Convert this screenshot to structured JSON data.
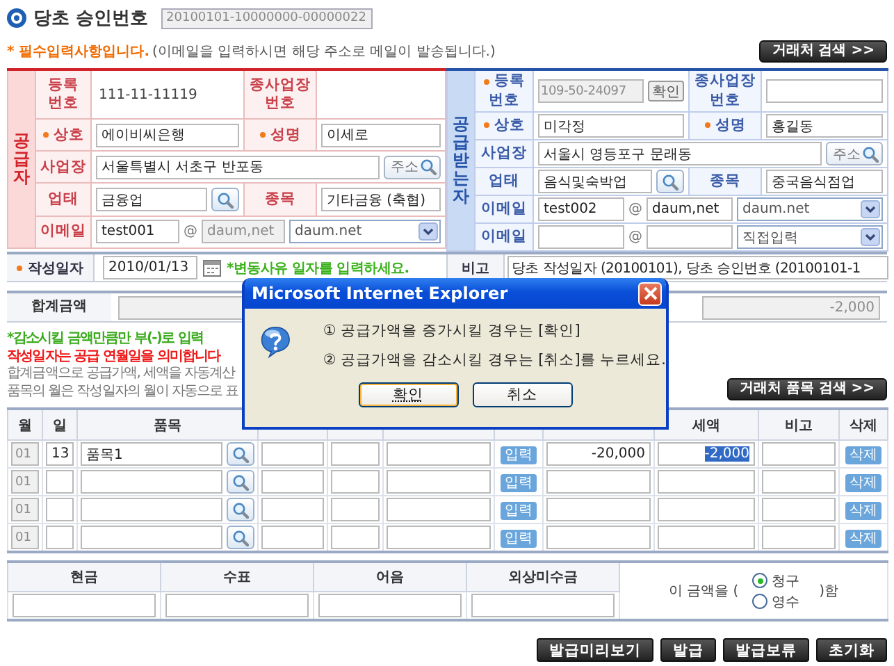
{
  "header": {
    "title": "당초 승인번호",
    "approval_no": "20100101-10000000-00000022"
  },
  "notice": {
    "required": "* 필수입력사항입니다.",
    "hint": "(이메일을 입력하시면 해당 주소로 메일이 발송됩니다.)",
    "search_button": "거래처 검색 >>"
  },
  "parties": [
    {
      "color": "#d2222a",
      "title": "공급자",
      "rows": [
        {
          "cells": [
            {
              "kind": "label",
              "text": "등록 번호",
              "required": false
            },
            {
              "kind": "text",
              "value": "111-11-11119"
            },
            {
              "kind": "label",
              "text": "종사업장 번호",
              "required": false
            },
            {
              "kind": "blank"
            }
          ]
        },
        {
          "cells": [
            {
              "kind": "label",
              "text": "상호",
              "required": true
            },
            {
              "kind": "field",
              "value": "에이비씨은행"
            },
            {
              "kind": "label",
              "text": "성명",
              "required": true
            },
            {
              "kind": "field",
              "value": "이세로"
            }
          ]
        },
        {
          "cells": [
            {
              "kind": "label",
              "text": "사업장",
              "required": false
            },
            {
              "kind": "address",
              "value": "서울특별시 서초구 반포동",
              "button": "주소",
              "colspan": 3
            }
          ]
        },
        {
          "cells": [
            {
              "kind": "label",
              "text": "업태",
              "required": false
            },
            {
              "kind": "search",
              "value": "금융업"
            },
            {
              "kind": "label",
              "text": "종목",
              "required": false
            },
            {
              "kind": "field",
              "value": "기타금융 (축협)"
            }
          ]
        },
        {
          "cells": [
            {
              "kind": "label",
              "text": "이메일",
              "required": false
            },
            {
              "kind": "email",
              "user": "test001",
              "at": "@",
              "domain": "daum,net",
              "domain_disabled": true,
              "select": "daum.net",
              "colspan": 3
            }
          ]
        }
      ]
    },
    {
      "color": "#2654a8",
      "title": "공급받는자",
      "rows": [
        {
          "cells": [
            {
              "kind": "label",
              "text": "등록 번호",
              "required": true
            },
            {
              "kind": "confirm",
              "value": "109-50-24097",
              "button": "확인"
            },
            {
              "kind": "label",
              "text": "종사업장 번호",
              "required": false
            },
            {
              "kind": "field"
            }
          ]
        },
        {
          "cells": [
            {
              "kind": "label",
              "text": "상호",
              "required": true
            },
            {
              "kind": "field",
              "value": "미각정"
            },
            {
              "kind": "label",
              "text": "성명",
              "required": true
            },
            {
              "kind": "field",
              "value": "홍길동"
            }
          ]
        },
        {
          "cells": [
            {
              "kind": "label",
              "text": "사업장",
              "required": false
            },
            {
              "kind": "address",
              "value": "서울시 영등포구 문래동",
              "button": "주소",
              "colspan": 3
            }
          ]
        },
        {
          "cells": [
            {
              "kind": "label",
              "text": "업태",
              "required": false
            },
            {
              "kind": "search",
              "value": "음식및숙박업"
            },
            {
              "kind": "label",
              "text": "종목",
              "required": false
            },
            {
              "kind": "field",
              "value": "중국음식점업"
            }
          ]
        },
        {
          "cells": [
            {
              "kind": "label",
              "text": "이메일",
              "required": false
            },
            {
              "kind": "email",
              "user": "test002",
              "at": "@",
              "domain": "daum,net",
              "domain_disabled": false,
              "select": "daum.net",
              "colspan": 3
            }
          ]
        },
        {
          "cells": [
            {
              "kind": "label",
              "text": "이메일",
              "required": false
            },
            {
              "kind": "email",
              "at": "@",
              "domain_disabled": false,
              "select": "직접입력",
              "colspan": 3
            }
          ]
        }
      ]
    }
  ],
  "date_row": {
    "label": "작성일자",
    "required": true,
    "date": "2010/01/13",
    "note": "*변동사유 일자를 입력하세요.",
    "remark_label": "비고",
    "remark": "당초 작성일자 (20100101), 당초 승인번호 (20100101-1"
  },
  "total": {
    "label": "합계금액",
    "fields": [
      {
        "readonly": true
      },
      {
        "readonly": true,
        "value": "-2,000"
      }
    ]
  },
  "notes": [
    {
      "kind": "hint",
      "text": "*감소시킬 금액만큼만 부(-)로 입력"
    },
    {
      "kind": "warning",
      "text": "작성일자는 공급 연월일을 의미합니다"
    },
    {
      "kind": "info",
      "text": "합계금액으로 공급가액, 세액을 자동계산"
    },
    {
      "kind": "info",
      "text": "품목의 월은 작성일자의 월이 자동으로 표"
    }
  ],
  "item_search_button": "거래처 품목 검색 >>",
  "items": {
    "columns": [
      {
        "label": "월"
      },
      {
        "label": "일"
      },
      {
        "label": "품목"
      },
      {},
      {},
      {},
      {},
      {},
      {
        "label": "세액"
      },
      {
        "label": "비고"
      },
      {
        "label": "삭제"
      }
    ],
    "rows": [
      {
        "month": "01",
        "day": "13",
        "item": "품목1",
        "input_button": "입력",
        "amount": "-20,000",
        "tax": "-2,000",
        "tax_selected": true,
        "delete_button": "삭제"
      },
      {
        "month": "01",
        "input_button": "입력",
        "delete_button": "삭제"
      },
      {
        "month": "01",
        "input_button": "입력",
        "delete_button": "삭제"
      },
      {
        "month": "01",
        "input_button": "입력",
        "delete_button": "삭제"
      }
    ]
  },
  "payment": {
    "columns": [
      "현금",
      "수표",
      "어음",
      "외상미수금"
    ],
    "claim": {
      "prefix": "이 금액을 (",
      "options": [
        {
          "label": "청구",
          "selected": true
        },
        {
          "label": "영수",
          "selected": false
        }
      ],
      "suffix": ")함"
    }
  },
  "buttons": [
    "발급미리보기",
    "발급",
    "발급보류",
    "초기화"
  ],
  "dialog": {
    "title": "Microsoft Internet Explorer",
    "lines": [
      "① 공급가액을 증가시킬 경우는 [확인]",
      "② 공급가액을 감소시킬 경우는 [취소]를 누르세요."
    ],
    "buttons": [
      {
        "label": "확인",
        "focused": true
      },
      {
        "label": "취소",
        "focused": false
      }
    ]
  }
}
